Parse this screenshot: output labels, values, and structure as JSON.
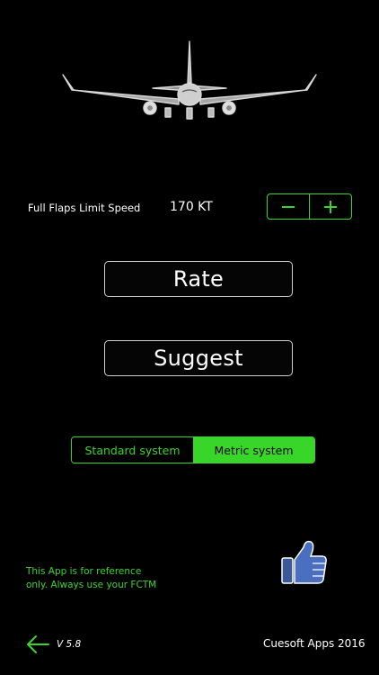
{
  "speed": {
    "label": "Full Flaps Limit Speed",
    "value": "170 KT"
  },
  "stepper": {
    "minus_icon": "minus-icon",
    "plus_icon": "plus-icon"
  },
  "buttons": {
    "rate": "Rate",
    "suggest": "Suggest"
  },
  "units": {
    "standard": "Standard system",
    "metric": "Metric system",
    "selected": "metric"
  },
  "disclaimer": {
    "line1": "This App is for reference",
    "line2": "only. Always use your FCTM"
  },
  "footer": {
    "version": "V 5.8",
    "copyright": "Cuesoft Apps 2016",
    "back_icon": "back-arrow-icon",
    "like_icon": "thumbs-up-icon"
  },
  "colors": {
    "accent": "#39d62a",
    "background": "#000000",
    "text": "#ffffff",
    "like_blue": "#3b5998"
  }
}
